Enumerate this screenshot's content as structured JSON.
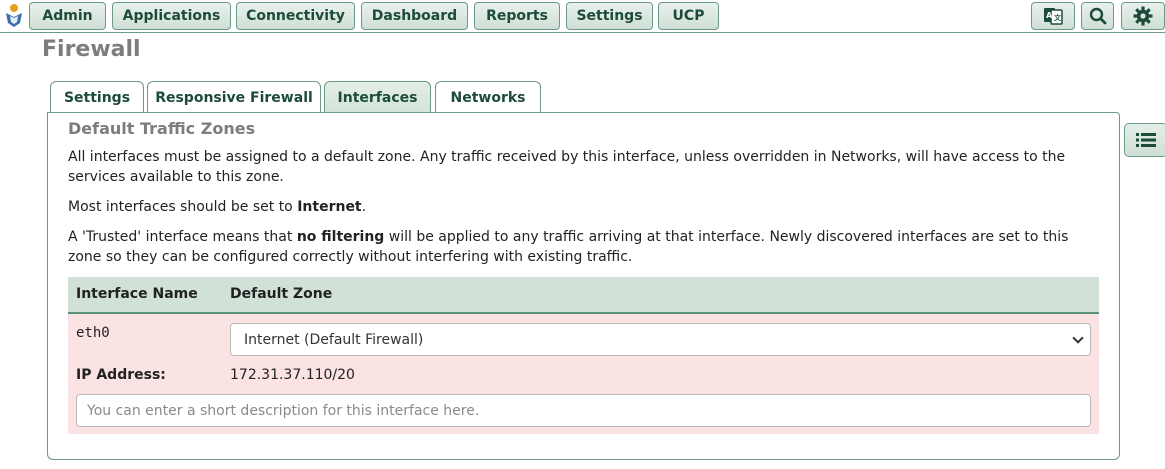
{
  "nav": {
    "items": [
      {
        "label": "Admin"
      },
      {
        "label": "Applications"
      },
      {
        "label": "Connectivity"
      },
      {
        "label": "Dashboard"
      },
      {
        "label": "Reports"
      },
      {
        "label": "Settings"
      },
      {
        "label": "UCP"
      }
    ],
    "icons": [
      "translate-icon",
      "search-icon",
      "gear-icon"
    ]
  },
  "page": {
    "title": "Firewall"
  },
  "tabs": [
    {
      "label": "Settings",
      "active": false
    },
    {
      "label": "Responsive Firewall",
      "active": false
    },
    {
      "label": "Interfaces",
      "active": true
    },
    {
      "label": "Networks",
      "active": false
    }
  ],
  "section": {
    "title": "Default Traffic Zones",
    "para1": "All interfaces must be assigned to a default zone. Any traffic received by this interface, unless overridden in Networks, will have access to the services available to this zone.",
    "para2_pre": "Most interfaces should be set to ",
    "para2_bold": "Internet",
    "para2_post": ".",
    "para3_pre": "A 'Trusted' interface means that ",
    "para3_bold": "no filtering",
    "para3_post": " will be applied to any traffic arriving at that interface. Newly discovered interfaces are set to this zone so they can be configured correctly without interfering with existing traffic."
  },
  "table": {
    "headers": [
      "Interface Name",
      "Default Zone"
    ],
    "rows": [
      {
        "interface": "eth0",
        "zone": "Internet (Default Firewall)",
        "ip_label": "IP Address:",
        "ip_value": "172.31.37.110/20",
        "description_placeholder": "You can enter a short description for this interface here."
      }
    ]
  },
  "colors": {
    "accent": "#6b9a86",
    "header_bg": "#d2e1d7",
    "row_bg": "#fbe3e3",
    "nav_text": "#1d4b3a"
  },
  "sidebar_toggle_icon": "list-icon"
}
